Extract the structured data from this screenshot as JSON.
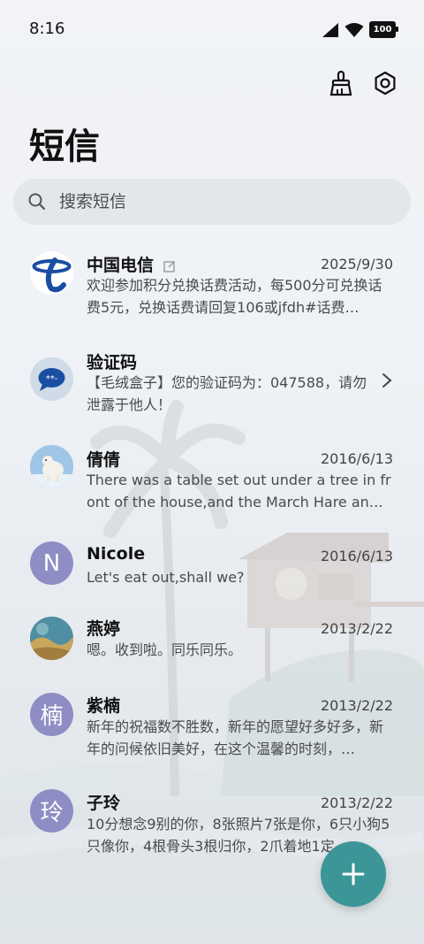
{
  "status_bar": {
    "time": "8:16",
    "battery": "100"
  },
  "header": {
    "title": "短信"
  },
  "search": {
    "placeholder": "搜索短信"
  },
  "messages": [
    {
      "name": "中国电信",
      "date": "2025/9/30",
      "preview": "欢迎参加积分兑换话费活动，每500分可兑换话费5元，兑换话费请回复106或jfdh#话费…",
      "avatar": "china-telecom-logo"
    },
    {
      "name": "验证码",
      "date": "",
      "preview": "【毛绒盒子】您的验证码为：047588，请勿泄露于他人！",
      "avatar": "verification-code-icon"
    },
    {
      "name": "倩倩",
      "date": "2016/6/13",
      "preview": "There was a table set out under a tree in front of the house,and the March Hare an…",
      "avatar": "polar-bear-photo"
    },
    {
      "name": "Nicole",
      "date": "2016/6/13",
      "preview": "Let's eat out,shall we?",
      "avatar_letter": "N"
    },
    {
      "name": "燕婷",
      "date": "2013/2/22",
      "preview": "嗯。收到啦。同乐同乐。",
      "avatar": "landscape-photo"
    },
    {
      "name": "紫楠",
      "date": "2013/2/22",
      "preview": "新年的祝福数不胜数，新年的愿望好多好多，新年的问候依旧美好，在这个温馨的时刻，…",
      "avatar_letter": "楠"
    },
    {
      "name": "子玲",
      "date": "2013/2/22",
      "preview": "10分想念9别的你，8张照片7张是你，6只小狗5只像你，4根骨头3根归你，2爪着地1定…",
      "avatar_letter": "玲"
    }
  ],
  "colors": {
    "fab": "#3c9596",
    "letter_avatar": "#8e8dc4",
    "telecom_blue": "#1a4ea2"
  }
}
